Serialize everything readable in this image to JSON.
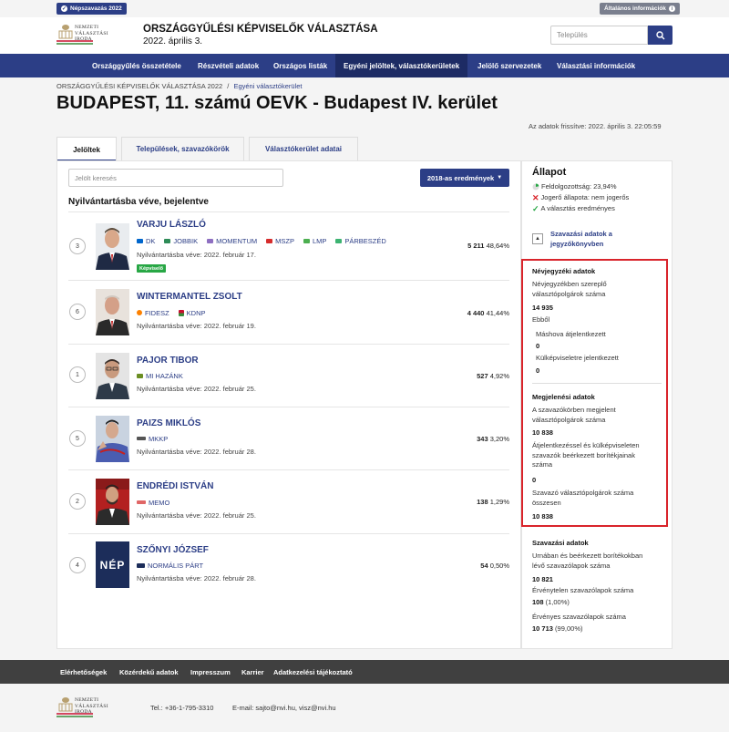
{
  "topbar": {
    "referendum_label": "Népszavazás 2022",
    "general_info_label": "Általános információk"
  },
  "header": {
    "logo_text": [
      "NEMZETI",
      "VÁLASZTÁSI",
      "IRODA"
    ],
    "title": "ORSZÁGGYŰLÉSI KÉPVISELŐK VÁLASZTÁSA",
    "date": "2022. április 3.",
    "search_placeholder": "Település"
  },
  "nav": {
    "items": [
      {
        "label": "Országgyűlés összetétele"
      },
      {
        "label": "Részvételi adatok"
      },
      {
        "label": "Országos listák"
      },
      {
        "label": "Egyéni jelöltek, választókerületek"
      },
      {
        "label": "Jelölő szervezetek"
      },
      {
        "label": "Választási információk"
      }
    ]
  },
  "breadcrumb": {
    "root": "ORSZÁGGYŰLÉSI KÉPVISELŐK VÁLASZTÁSA 2022",
    "separator": "/",
    "current": "Egyéni választókerület"
  },
  "page": {
    "title": "BUDAPEST, 11. számú OEVK - Budapest IV. kerület",
    "refresh": "Az adatok frissítve: 2022. április 3. 22:05:59"
  },
  "tabs": [
    {
      "label": "Jelöltek"
    },
    {
      "label": "Települések, szavazókörök"
    },
    {
      "label": "Választókerület adatai"
    }
  ],
  "candidates_panel": {
    "search_placeholder": "Jelölt keresés",
    "results_button": "2018-as eredmények",
    "section_title": "Nyilvántartásba véve, bejelentve",
    "rep_badge": "Képviselő",
    "candidates": [
      {
        "ballot": "3",
        "name": "VARJU LÁSZLÓ",
        "parties": [
          "DK",
          "JOBBIK",
          "MOMENTUM",
          "MSZP",
          "LMP",
          "PÁRBESZÉD"
        ],
        "registered": "Nyilvántartásba véve: 2022. február 17.",
        "votes": "5 211",
        "percent": "48,64%"
      },
      {
        "ballot": "6",
        "name": "WINTERMANTEL ZSOLT",
        "parties": [
          "FIDESZ",
          "KDNP"
        ],
        "registered": "Nyilvántartásba véve: 2022. február 19.",
        "votes": "4 440",
        "percent": "41,44%"
      },
      {
        "ballot": "1",
        "name": "PAJOR TIBOR",
        "parties": [
          "MI HAZÁNK"
        ],
        "registered": "Nyilvántartásba véve: 2022. február 25.",
        "votes": "527",
        "percent": "4,92%"
      },
      {
        "ballot": "5",
        "name": "PAIZS MIKLÓS",
        "parties": [
          "MKKP"
        ],
        "registered": "Nyilvántartásba véve: 2022. február 28.",
        "votes": "343",
        "percent": "3,20%"
      },
      {
        "ballot": "2",
        "name": "ENDRÉDI ISTVÁN",
        "parties": [
          "MEMO"
        ],
        "registered": "Nyilvántartásba véve: 2022. február 25.",
        "votes": "138",
        "percent": "1,29%"
      },
      {
        "ballot": "4",
        "name": "SZŐNYI JÓZSEF",
        "parties": [
          "NORMÁLIS PÁRT"
        ],
        "registered": "Nyilvántartásba véve: 2022. február 28.",
        "votes": "54",
        "percent": "0,50%"
      }
    ],
    "nep_logo_text": "NÉP"
  },
  "sidebar": {
    "status_title": "Állapot",
    "processed": "Feldolgozottság: 23,94%",
    "legal_status": "Jogerő állapota: nem jogerős",
    "results_status": "A választás eredményes",
    "minutes_link": [
      "Szavazási adatok a",
      "jegyzőkönyvben"
    ],
    "register_title": "Névjegyzéki adatok",
    "register_count_label": [
      "Névjegyzékben szereplő",
      "választópolgárok száma"
    ],
    "register_count": "14 935",
    "of_which": "Ebből",
    "transferred_label": "Máshova átjelentkezett",
    "transferred": "0",
    "abroad_label": "Külképviseletre jelentkezett",
    "abroad": "0",
    "turnout_title": "Megjelenési adatok",
    "appeared_label": [
      "A szavazókörben megjelent",
      "választópolgárok száma"
    ],
    "appeared": "10 838",
    "envelopes_label": [
      "Átjelentkezéssel és külképviseleten",
      "szavazók beérkezett borítékjainak",
      "száma"
    ],
    "envelopes": "0",
    "voters_total_label": [
      "Szavazó választópolgárok száma",
      "összesen"
    ],
    "voters_total": "10 838",
    "voting_title": "Szavazási adatok",
    "ballots_label": [
      "Urnában és beérkezett borítékokban",
      "lévő szavazólapok száma"
    ],
    "ballots": "10 821",
    "invalid_label": "Érvénytelen szavazólapok száma",
    "invalid": "108",
    "invalid_pct": "(1,00%)",
    "valid_label": "Érvényes szavazólapok száma",
    "valid": "10 713",
    "valid_pct": "(99,00%)"
  },
  "footer": {
    "links": [
      {
        "label": "Elérhetőségek"
      },
      {
        "label": "Közérdekű adatok"
      },
      {
        "label": "Impresszum"
      },
      {
        "label": "Karrier"
      },
      {
        "label": "Adatkezelési tájékoztató"
      }
    ],
    "phone": "Tel.: +36-1-795-3310",
    "email": "E-mail: sajto@nvi.hu, visz@nvi.hu"
  },
  "colors": {
    "brand": "#2c3e86",
    "highlight": "#d9242b",
    "success": "#28a745"
  }
}
